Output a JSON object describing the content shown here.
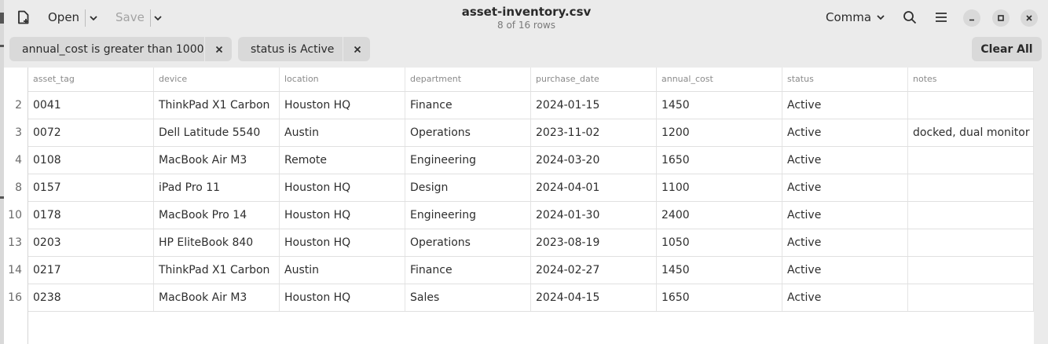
{
  "window": {
    "title": "asset-inventory.csv",
    "subtitle": "8 of 16 rows"
  },
  "toolbar": {
    "open_label": "Open",
    "save_label": "Save",
    "delimiter_label": "Comma",
    "icons": [
      "new-document-icon",
      "chevron-down-icon",
      "search-icon",
      "hamburger-menu-icon",
      "minimize-icon",
      "maximize-icon",
      "close-icon"
    ]
  },
  "filters": [
    {
      "label": "annual_cost is greater than 1000"
    },
    {
      "label": "status is Active"
    }
  ],
  "clear_all_label": "Clear All",
  "table": {
    "columns": [
      "asset_tag",
      "device",
      "location",
      "department",
      "purchase_date",
      "annual_cost",
      "status",
      "notes"
    ],
    "rows": [
      {
        "num": "2",
        "cells": [
          "0041",
          "ThinkPad X1 Carbon",
          "Houston HQ",
          "Finance",
          "2024-01-15",
          "1450",
          "Active",
          ""
        ]
      },
      {
        "num": "3",
        "cells": [
          "0072",
          "Dell Latitude 5540",
          "Austin",
          "Operations",
          "2023-11-02",
          "1200",
          "Active",
          "docked, dual monitor"
        ]
      },
      {
        "num": "4",
        "cells": [
          "0108",
          "MacBook Air M3",
          "Remote",
          "Engineering",
          "2024-03-20",
          "1650",
          "Active",
          ""
        ]
      },
      {
        "num": "8",
        "cells": [
          "0157",
          "iPad Pro 11",
          "Houston HQ",
          "Design",
          "2024-04-01",
          "1100",
          "Active",
          ""
        ]
      },
      {
        "num": "10",
        "cells": [
          "0178",
          "MacBook Pro 14",
          "Houston HQ",
          "Engineering",
          "2024-01-30",
          "2400",
          "Active",
          ""
        ]
      },
      {
        "num": "13",
        "cells": [
          "0203",
          "HP EliteBook 840",
          "Houston HQ",
          "Operations",
          "2023-08-19",
          "1050",
          "Active",
          ""
        ]
      },
      {
        "num": "14",
        "cells": [
          "0217",
          "ThinkPad X1 Carbon",
          "Austin",
          "Finance",
          "2024-02-27",
          "1450",
          "Active",
          ""
        ]
      },
      {
        "num": "16",
        "cells": [
          "0238",
          "MacBook Air M3",
          "Houston HQ",
          "Sales",
          "2024-04-15",
          "1650",
          "Active",
          ""
        ]
      }
    ]
  }
}
